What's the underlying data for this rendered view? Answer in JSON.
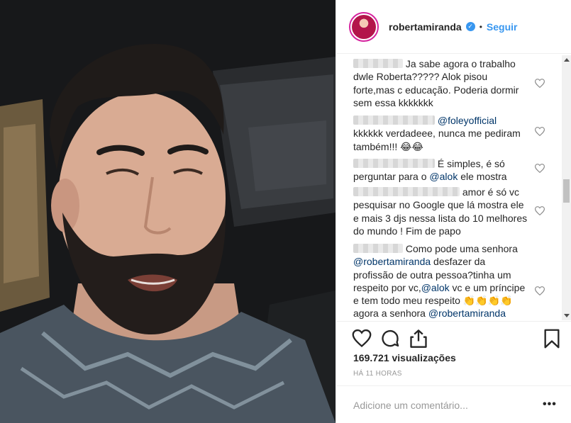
{
  "post": {
    "username": "robertamiranda",
    "dot": "•",
    "follow_label": "Seguir"
  },
  "comments": [
    {
      "lines": [
        "Ja sabe agora o trabalho",
        "dwle Roberta????? Alok pisou",
        "forte,mas c educação. Poderia dormir",
        "sem essa kkkkkkk"
      ]
    },
    {
      "mention": "@foleyofficial",
      "lines": [
        "kkkkkk verdadeee, nunca me pediram",
        "também!!! 😂😂"
      ]
    },
    {
      "lines": [
        "É simples, é só",
        "perguntar para o"
      ],
      "mention": "@alok",
      "after": "ele mostra"
    },
    {
      "lines": [
        "amor é só vc",
        "pesquisar no Google que lá mostra ele",
        "e mais 3 djs nessa lista do 10 melhores",
        "do mundo ! Fim de papo"
      ]
    },
    {
      "lines": [
        "Como pode uma senhora",
        "desfazer da",
        "profissão de outra pessoa?tinha um",
        "respeito por vc,",
        "vc e um príncipe",
        "e tem todo meu respeito 👏👏👏👏",
        "agora a senhora"
      ],
      "mentions": [
        "@robertamiranda",
        "@alok",
        "@robertamiranda"
      ]
    }
  ],
  "stats": {
    "views": "169.721 visualizações",
    "time": "HÁ 11 HORAS"
  },
  "add_comment": {
    "placeholder": "Adicione um comentário...",
    "more": "•••"
  },
  "icons": [
    "heart-icon",
    "comment-icon",
    "share-icon",
    "bookmark-icon",
    "verified-icon"
  ]
}
